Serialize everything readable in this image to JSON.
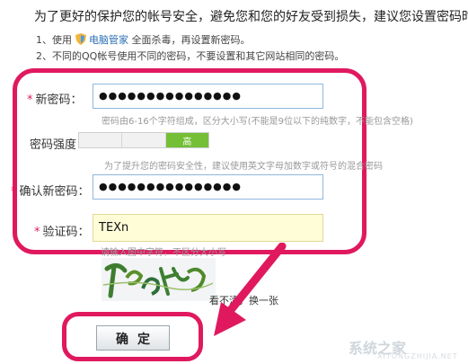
{
  "intro": "为了更好的保护您的帐号安全，避免您和您的好友受到损失，建议您设置密码时：",
  "tips": {
    "tip1_before": "1、使用",
    "tip1_brand": "电脑管家",
    "tip1_after": "全面杀毒，再设置新密码。",
    "tip2": "2、不同的QQ帐号使用不同的密码，不要设置和其它网站相同的密码。"
  },
  "form": {
    "required_mark": "*",
    "new_password": {
      "label": "新密码：",
      "value": "●●●●●●●●●●●●●●●",
      "hint": "密码由6-16个字符组成，区分大小写(不能是9位以下的纯数字，不能包含空格)"
    },
    "strength": {
      "label": "密码强度：",
      "level_text": "高",
      "level": 3,
      "max_level": 3,
      "hint": "为了提升您的密码安全性，建议使用英文字母加数字或符号的混合密码"
    },
    "confirm_password": {
      "label": "确认新密码：",
      "value": "●●●●●●●●●●●●●●●"
    },
    "captcha": {
      "label": "验证码：",
      "value": "TEXn",
      "hint": "请输入图中字符，不区分大小写",
      "refresh_text": "看不清，换一张"
    }
  },
  "submit_label": "确定",
  "watermark": {
    "text": "系统之家",
    "url": "XITONGZHIJIA.NET"
  },
  "colors": {
    "highlight": "#e0195f",
    "strength_fill": "#74bf36",
    "input_border": "#8fb7dc"
  }
}
